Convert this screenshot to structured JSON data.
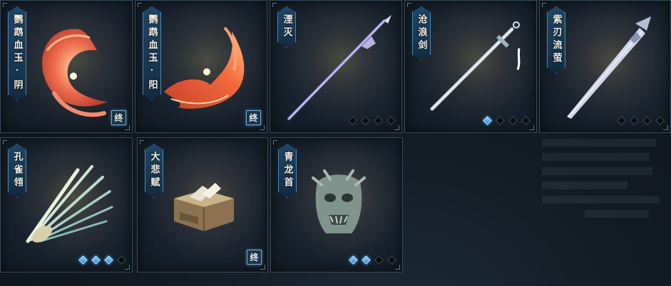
{
  "items": [
    {
      "name": "鹦鹉血玉·阴",
      "badge": "终",
      "stars": null,
      "icon": "red-phoenix-feather-icon"
    },
    {
      "name": "鹦鹉血玉·阳",
      "badge": "终",
      "stars": null,
      "icon": "red-phoenix-wing-icon"
    },
    {
      "name": "湮灭",
      "badge": null,
      "stars": {
        "filled": 0,
        "total": 4
      },
      "icon": "spear-icon"
    },
    {
      "name": "沧浪剑",
      "badge": null,
      "stars": {
        "filled": 1,
        "total": 4
      },
      "icon": "sword-icon"
    },
    {
      "name": "紫刃流萤",
      "badge": null,
      "stars": {
        "filled": 0,
        "total": 4
      },
      "icon": "blade-icon"
    },
    {
      "name": "孔雀翎",
      "badge": null,
      "stars": {
        "filled": 3,
        "total": 4
      },
      "icon": "peacock-feather-icon"
    },
    {
      "name": "大悲赋",
      "badge": "终",
      "stars": null,
      "icon": "book-box-icon"
    },
    {
      "name": "青龙首",
      "badge": null,
      "stars": {
        "filled": 2,
        "total": 4
      },
      "icon": "dragon-head-icon"
    }
  ],
  "colors": {
    "accent": "#4b86b3",
    "diamond_on": "#2f86d1",
    "background": "#121a22"
  }
}
